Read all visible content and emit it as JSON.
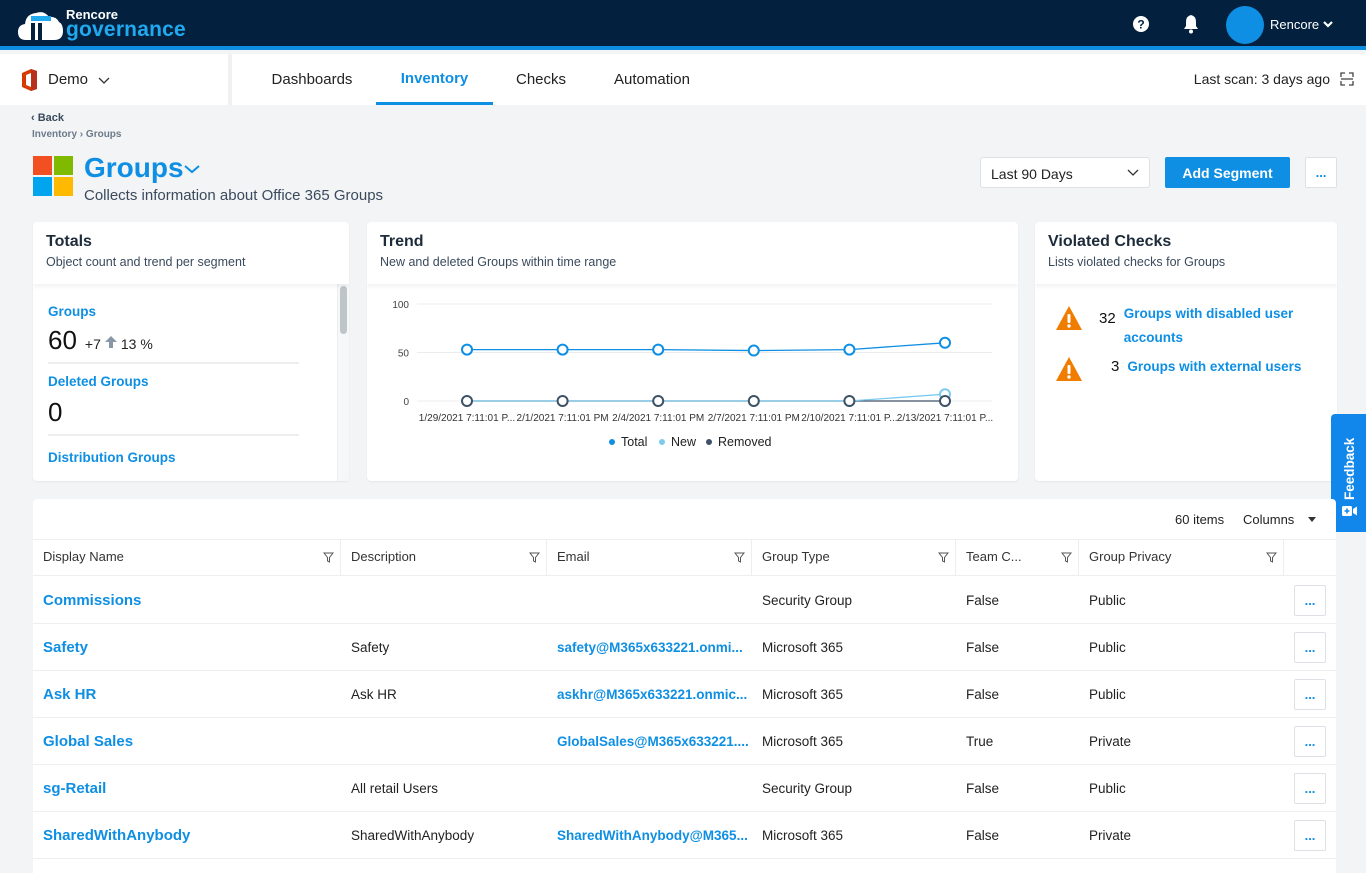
{
  "app": {
    "brand_line1": "Rencore",
    "brand_line2": "governance",
    "user_name": "Rencore",
    "accent_color": "#0f8fe3",
    "header_bg": "#03213f"
  },
  "nav": {
    "tenant": "Demo",
    "tabs": [
      {
        "label": "Dashboards",
        "active": false
      },
      {
        "label": "Inventory",
        "active": true
      },
      {
        "label": "Checks",
        "active": false
      },
      {
        "label": "Automation",
        "active": false
      }
    ],
    "last_scan_label": "Last scan:",
    "last_scan_value": "3 days ago"
  },
  "page": {
    "back_label": "Back",
    "breadcrumb": [
      "Inventory",
      "Groups"
    ],
    "breadcrumb_sep": "›",
    "title": "Groups",
    "subtitle": "Collects information about Office 365 Groups",
    "range_select": "Last 90 Days",
    "add_segment_label": "Add Segment",
    "more_label": "..."
  },
  "totals": {
    "title": "Totals",
    "subtitle": "Object count and trend per segment",
    "items": [
      {
        "label": "Groups",
        "value": "60",
        "delta": "+7",
        "trend_direction": "up",
        "percent": "13 %"
      },
      {
        "label": "Deleted Groups",
        "value": "0"
      },
      {
        "label": "Distribution Groups"
      }
    ]
  },
  "trend": {
    "title": "Trend",
    "subtitle": "New and deleted Groups within time range"
  },
  "chart_data": {
    "type": "line",
    "title": "Trend",
    "x": [
      "1/29/2021 7:11:01 P...",
      "2/1/2021 7:11:01 PM",
      "2/4/2021 7:11:01 PM",
      "2/7/2021 7:11:01 PM",
      "2/10/2021 7:11:01 P...",
      "2/13/2021 7:11:01 P..."
    ],
    "ylim": [
      0,
      100
    ],
    "yticks": [
      0,
      50,
      100
    ],
    "grid": true,
    "legend": "bottom-center",
    "series": [
      {
        "name": "Total",
        "color": "#0f8fe3",
        "values": [
          53,
          53,
          53,
          52,
          53,
          60
        ]
      },
      {
        "name": "New",
        "color": "#7ccbef",
        "values": [
          0,
          0,
          0,
          0,
          0,
          7
        ]
      },
      {
        "name": "Removed",
        "color": "#3d5266",
        "values": [
          0,
          0,
          0,
          0,
          0,
          0
        ]
      }
    ]
  },
  "violated": {
    "title": "Violated Checks",
    "subtitle": "Lists violated checks for Groups",
    "items": [
      {
        "count": "32",
        "label": "Groups with disabled user accounts"
      },
      {
        "count": "3",
        "label": "Groups with external users"
      }
    ]
  },
  "feedback_label": "Feedback",
  "grid": {
    "items_count": "60 items",
    "columns_label": "Columns",
    "headers": [
      "Display Name",
      "Description",
      "Email",
      "Group Type",
      "Team C...",
      "Group Privacy"
    ],
    "rows": [
      {
        "name": "Commissions",
        "description": "",
        "email": "",
        "type": "Security Group",
        "team": "False",
        "privacy": "Public"
      },
      {
        "name": "Safety",
        "description": "Safety",
        "email": "safety@M365x633221.onmi...",
        "type": "Microsoft 365",
        "team": "False",
        "privacy": "Public"
      },
      {
        "name": "Ask HR",
        "description": "Ask HR",
        "email": "askhr@M365x633221.onmic...",
        "type": "Microsoft 365",
        "team": "False",
        "privacy": "Public"
      },
      {
        "name": "Global Sales",
        "description": "",
        "email": "GlobalSales@M365x633221....",
        "type": "Microsoft 365",
        "team": "True",
        "privacy": "Private"
      },
      {
        "name": "sg-Retail",
        "description": "All retail Users",
        "email": "",
        "type": "Security Group",
        "team": "False",
        "privacy": "Public"
      },
      {
        "name": "SharedWithAnybody",
        "description": "SharedWithAnybody",
        "email": "SharedWithAnybody@M365...",
        "type": "Microsoft 365",
        "team": "False",
        "privacy": "Private"
      }
    ],
    "row_more_label": "..."
  }
}
